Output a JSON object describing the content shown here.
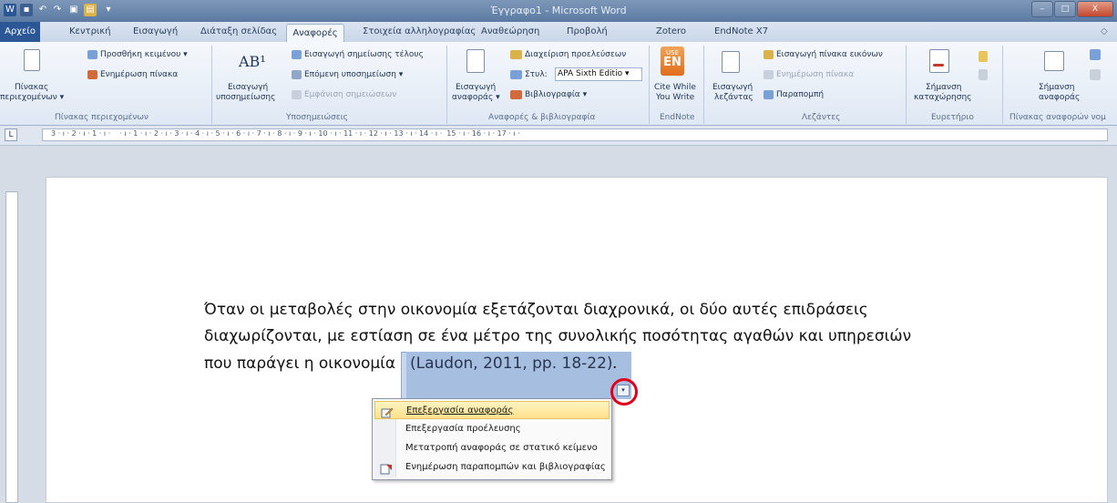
{
  "window": {
    "title": "Έγγραφο1 - Microsoft Word",
    "minimize": "–",
    "maximize": "□",
    "close": "X"
  },
  "quick_access": {
    "word": "W",
    "save": "▪",
    "undo": "↶",
    "redo": "↷",
    "print": "▣",
    "open": "▤",
    "more": "▾"
  },
  "tabs": [
    {
      "label": "Αρχείο"
    },
    {
      "label": "Κεντρική"
    },
    {
      "label": "Εισαγωγή"
    },
    {
      "label": "Διάταξη σελίδας"
    },
    {
      "label": "Αναφορές"
    },
    {
      "label": "Στοιχεία αλληλογραφίας"
    },
    {
      "label": "Αναθεώρηση"
    },
    {
      "label": "Προβολή"
    },
    {
      "label": "Zotero"
    },
    {
      "label": "EndNote X7"
    }
  ],
  "help_glyph": "◇",
  "ribbon": {
    "toc": {
      "big": [
        "Πίνακας",
        "περιεχομένων ▾"
      ],
      "add_text": "Προσθήκη κειμένου ▾",
      "update": "Ενημέρωση πίνακα",
      "group": "Πίνακας περιεχομένων"
    },
    "footnotes": {
      "big_icon": "AB¹",
      "big": [
        "Εισαγωγή",
        "υποσημείωσης"
      ],
      "endnote": "Εισαγωγή σημείωσης τέλους",
      "next": "Επόμενη υποσημείωση ▾",
      "show": "Εμφάνιση σημειώσεων",
      "group": "Υποσημειώσεις"
    },
    "citations": {
      "big": [
        "Εισαγωγή",
        "αναφοράς ▾"
      ],
      "manage": "Διαχείριση προελεύσεων",
      "style_label": "Στυλ:",
      "style_value": "APA Sixth Editio",
      "bibliography": "Βιβλιογραφία ▾",
      "group": "Αναφορές & βιβλιογραφία"
    },
    "endnote": {
      "icon_top": "USE",
      "icon_bottom": "EN",
      "big": [
        "Cite While",
        "You Write"
      ],
      "group": "EndNote"
    },
    "captions": {
      "big": [
        "Εισαγωγή",
        "λεζάντας"
      ],
      "insert_table": "Εισαγωγή πίνακα εικόνων",
      "update": "Ενημέρωση πίνακα",
      "cross_ref": "Παραπομπή",
      "group": "Λεζάντες"
    },
    "index": {
      "big": [
        "Σήμανση",
        "καταχώρησης"
      ],
      "group": "Ευρετήριο"
    },
    "authorities": {
      "big": [
        "Σήμανση",
        "αναφοράς"
      ],
      "group": "Πίνακας αναφορών νομ"
    }
  },
  "ruler": {
    "tab_selector": "L",
    "numbers": "3 · ı · 2 · ı · 1 · ı ·    · ı · 1 · ı · 2 · ı · 3 · ı · 4 · ı · 5 · ı · 6 · ı · 7 · ı · 8 · ı · 9 · ı · 10 · ı · 11 · ı · 12 · ı · 13 · ı · 14 · ı ·  15 · ı · 16 · ı · 17 · ı ·"
  },
  "document": {
    "line1": "Όταν οι μεταβολές στην οικονομία εξετάζονται διαχρονικά, οι δύο αυτές επιδράσεις",
    "line2": "διαχωρίζονται, με εστίαση σε ένα μέτρο της συνολικής ποσότητας αγαθών και υπηρεσιών",
    "line3_prefix": "που παράγει η οικονομία",
    "citation": "(Laudon, 2011, pp. 18-22)",
    "line3_suffix": "."
  },
  "citation_dropdown": "▾",
  "context_menu": {
    "items": [
      {
        "label": "Επεξεργασία αναφοράς",
        "icon": "edit-icon"
      },
      {
        "label": "Επεξεργασία προέλευσης",
        "icon": ""
      },
      {
        "label": "Μετατροπή αναφοράς σε στατικό κείμενο",
        "icon": ""
      },
      {
        "label": "Ενημέρωση παραπομπών και βιβλιογραφίας",
        "icon": "update-icon"
      }
    ]
  },
  "colors": {
    "file_tab": "#2b5797",
    "citation_highlight": "#a6bfe0",
    "menu_hover": "#ffe08a",
    "annotation_circle": "#e0001b"
  }
}
